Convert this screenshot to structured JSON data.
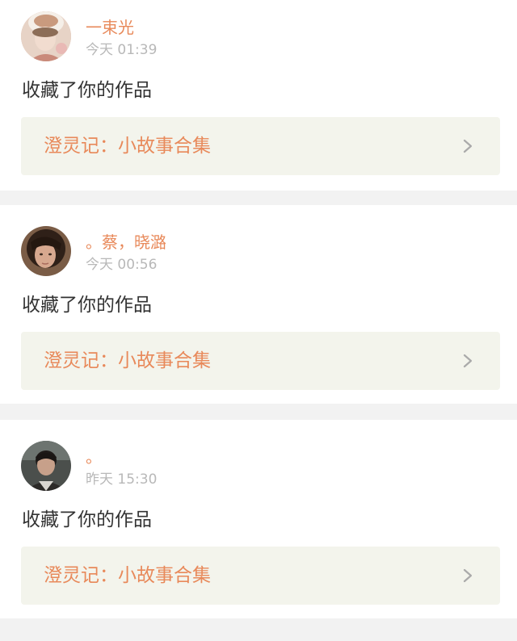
{
  "feed": {
    "items": [
      {
        "username": "一束光",
        "time": "今天 01:39",
        "action": "收藏了你的作品",
        "work_title": "澄灵记：小故事合集",
        "avatar_icon": "avatar-icon"
      },
      {
        "username": "。蔡，晓潞",
        "time": "今天 00:56",
        "action": "收藏了你的作品",
        "work_title": "澄灵记：小故事合集",
        "avatar_icon": "avatar-icon"
      },
      {
        "username": "。",
        "time": "昨天 15:30",
        "action": "收藏了你的作品",
        "work_title": "澄灵记：小故事合集",
        "avatar_icon": "avatar-icon"
      }
    ]
  },
  "colors": {
    "accent": "#e8895a",
    "time": "#b8b8b8",
    "text": "#333333",
    "link_bg": "#f3f4ec",
    "page_bg": "#f2f2f2"
  },
  "icons": {
    "chevron": "chevron-right-icon"
  }
}
